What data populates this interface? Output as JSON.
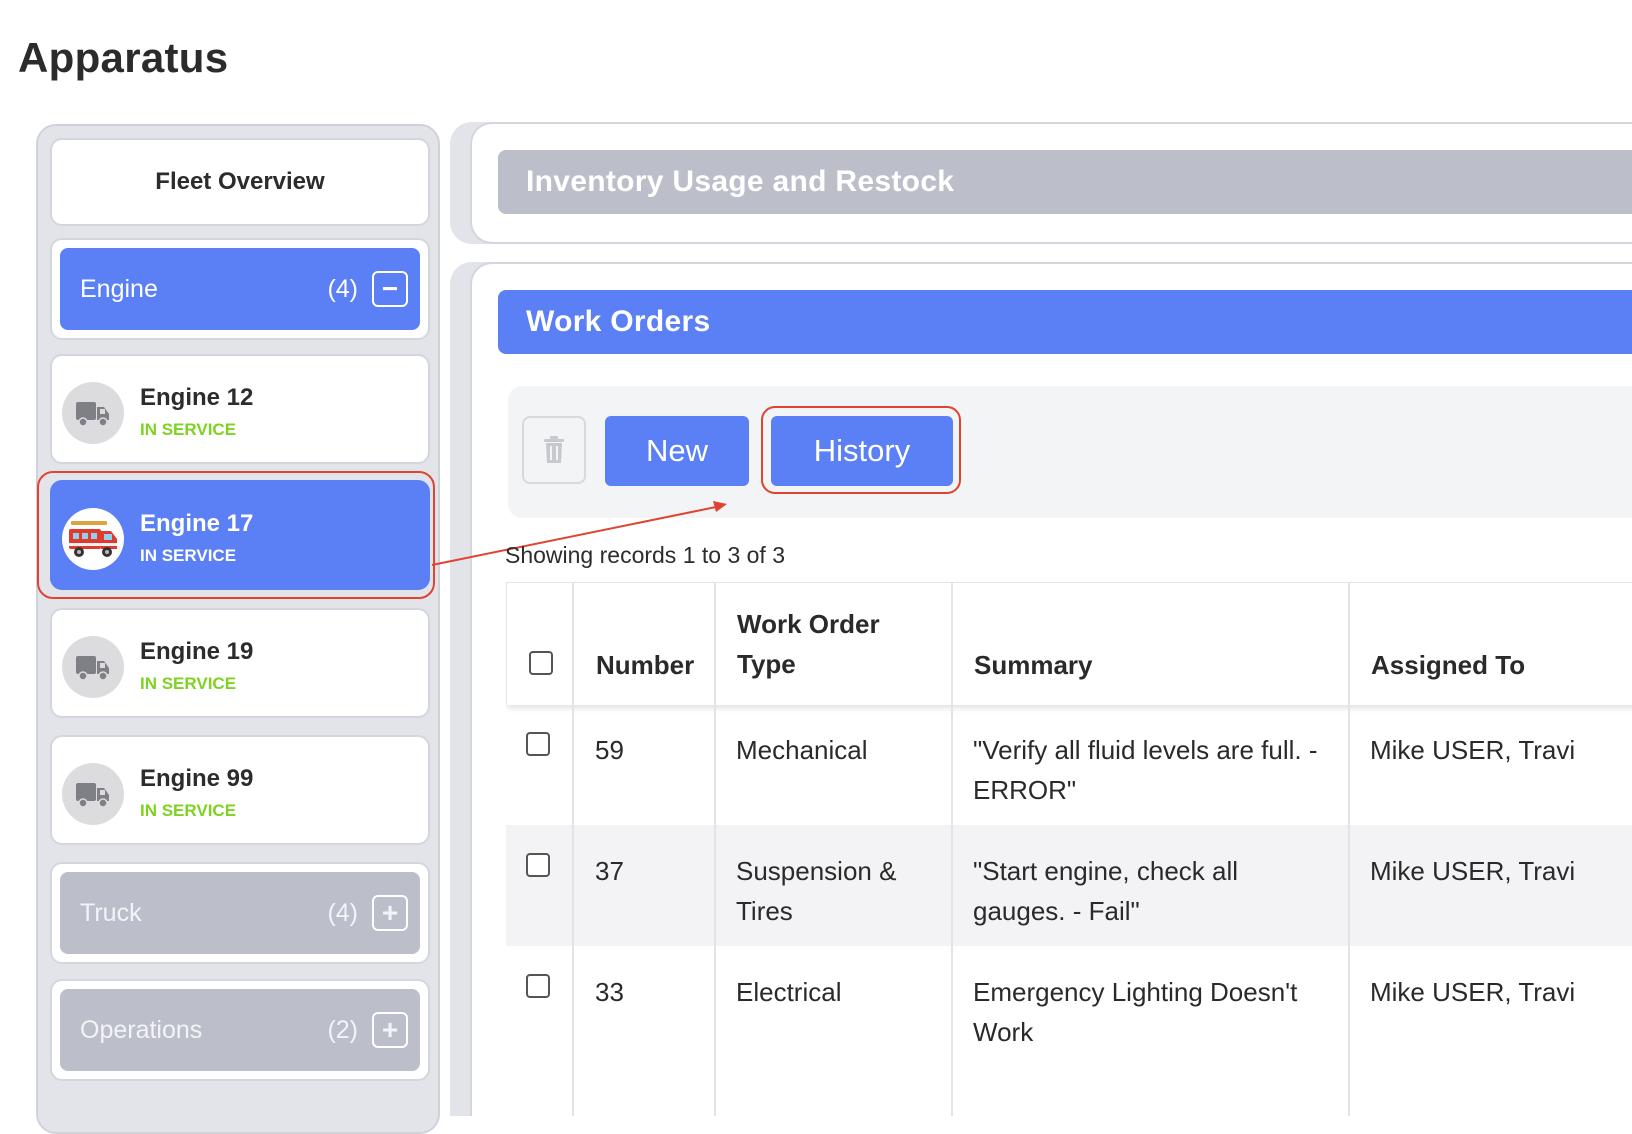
{
  "page": {
    "title": "Apparatus"
  },
  "sidebar": {
    "fleet_overview": "Fleet Overview",
    "groups": [
      {
        "label": "Engine",
        "count": "(4)",
        "toggle": "−",
        "expanded": true
      },
      {
        "label": "Truck",
        "count": "(4)",
        "toggle": "+",
        "expanded": false
      },
      {
        "label": "Operations",
        "count": "(2)",
        "toggle": "+",
        "expanded": false
      }
    ],
    "units": [
      {
        "name": "Engine 12",
        "status": "IN SERVICE",
        "icon": "truck-icon",
        "selected": false
      },
      {
        "name": "Engine 17",
        "status": "IN SERVICE",
        "icon": "fire-engine-icon",
        "selected": true
      },
      {
        "name": "Engine 19",
        "status": "IN SERVICE",
        "icon": "truck-icon",
        "selected": false
      },
      {
        "name": "Engine 99",
        "status": "IN SERVICE",
        "icon": "truck-icon",
        "selected": false
      }
    ]
  },
  "inventory": {
    "title": "Inventory Usage and Restock"
  },
  "work_orders": {
    "title": "Work Orders",
    "toolbar": {
      "trash_icon": "trash-icon",
      "new_label": "New",
      "history_label": "History"
    },
    "records_text": "Showing records 1 to 3 of 3",
    "columns": [
      "Number",
      "Work Order\nType",
      "Summary",
      "Assigned To"
    ],
    "rows": [
      {
        "number": "59",
        "type": "Mechanical",
        "summary": "\"Verify all fluid levels are full. - ERROR\"",
        "assigned": "Mike USER, Travi"
      },
      {
        "number": "37",
        "type": "Suspension & Tires",
        "summary": "\"Start engine, check all gauges. - Fail\"",
        "assigned": "Mike USER, Travi"
      },
      {
        "number": "33",
        "type": "Electrical",
        "summary": "Emergency Lighting Doesn't Work",
        "assigned": "Mike USER, Travi"
      }
    ]
  },
  "colors": {
    "accent": "#5b7ff5",
    "inactive_group": "#bcbfca",
    "status_green": "#7ed321",
    "annotation_red": "#e0432f"
  }
}
